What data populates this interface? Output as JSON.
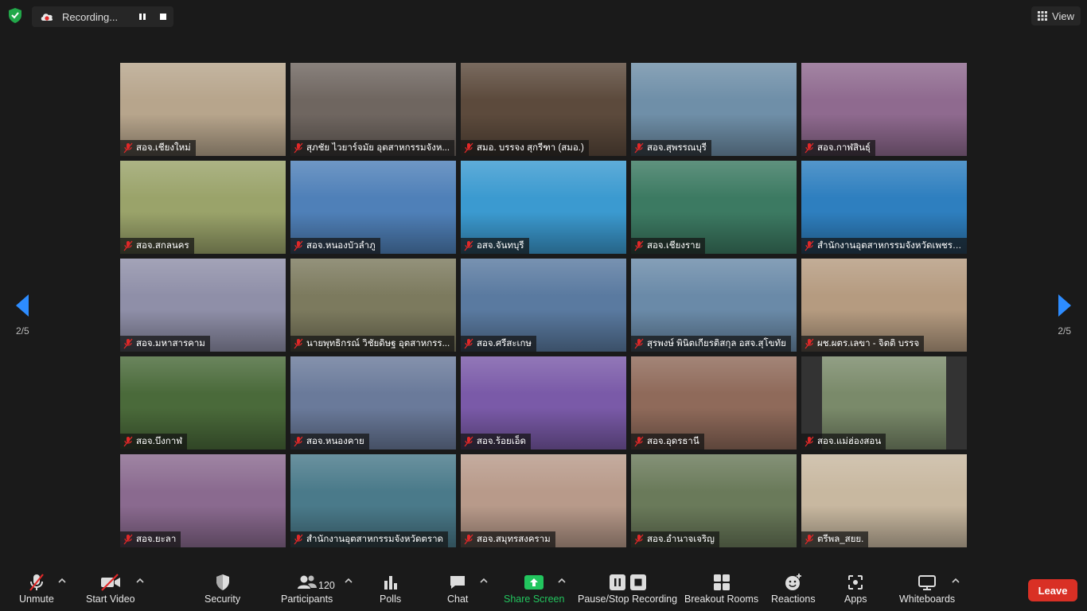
{
  "recording": {
    "label": "Recording..."
  },
  "view": {
    "label": "View"
  },
  "pagination": {
    "left": "2/5",
    "right": "2/5"
  },
  "tiles": [
    {
      "name": "สอจ.เชียงใหม่",
      "bg": "#b7a58c"
    },
    {
      "name": "สุภชัย ไวยาร์จมัย อุตสาหกรรมจังห...",
      "bg": "#6f6660"
    },
    {
      "name": "สมอ. บรรจง สุกรีฑา (สมอ.)",
      "bg": "#5c4a3c"
    },
    {
      "name": "สอจ.สุพรรณบุรี",
      "bg": "#6f8fa8"
    },
    {
      "name": "สอจ.กาฬสินธุ์",
      "bg": "#8f6a8f"
    },
    {
      "name": "สอจ.สกลนคร",
      "bg": "#9aa36a"
    },
    {
      "name": "สอจ.หนองบัวลำภู",
      "bg": "#4f80b8"
    },
    {
      "name": "อสจ.จันทบุรี",
      "bg": "#3b9ad0"
    },
    {
      "name": "สอจ.เชียงราย",
      "bg": "#3c7a62"
    },
    {
      "name": "สำนักงานอุตสาหกรรมจังหวัดเพชรบุรี",
      "bg": "#2e7fbf"
    },
    {
      "name": "สอจ.มหาสารคาม",
      "bg": "#8f8fa8"
    },
    {
      "name": "นายพุทธิกรณ์ วิชัยดิษฐ อุตสาหกรร...",
      "bg": "#7c7a5e"
    },
    {
      "name": "สอจ.ศรีสะเกษ",
      "bg": "#5a7aa0"
    },
    {
      "name": "สุรพงษ์ พินิตเกียรติสกุล อสจ.สุโขทัย",
      "bg": "#6a8aa8"
    },
    {
      "name": "ผช.ผตร.เลขา - จิตติ บรรจ",
      "bg": "#b59b80"
    },
    {
      "name": "สอจ.บึงกาฬ",
      "bg": "#4a6a3a"
    },
    {
      "name": "สอจ.หนองคาย",
      "bg": "#6a7a9a"
    },
    {
      "name": "สอจ.ร้อยเอ็ด",
      "bg": "#7a5aa8"
    },
    {
      "name": "สอจ.อุดรธานี",
      "bg": "#8f6a5a"
    },
    {
      "name": "สอจ.แม่ฮ่องสอน",
      "bg": "#7a8a6a"
    },
    {
      "name": "สอจ.ยะลา",
      "bg": "#8a6a8f"
    },
    {
      "name": "สำนักงานอุตสาหกรรมจังหวัดตราด",
      "bg": "#4a7a8a"
    },
    {
      "name": "สอจ.สมุทรสงคราม",
      "bg": "#b89a8a"
    },
    {
      "name": "สอจ.อำนาจเจริญ",
      "bg": "#6a7a5a"
    },
    {
      "name": "ตรีพล_สยย.",
      "bg": "#c8b8a0"
    }
  ],
  "toolbar": {
    "unmute": "Unmute",
    "start_video": "Start Video",
    "security": "Security",
    "participants": "Participants",
    "participants_count": "120",
    "polls": "Polls",
    "chat": "Chat",
    "share_screen": "Share Screen",
    "pause_stop_recording": "Pause/Stop Recording",
    "breakout_rooms": "Breakout Rooms",
    "reactions": "Reactions",
    "apps": "Apps",
    "whiteboards": "Whiteboards",
    "leave": "Leave"
  },
  "colors": {
    "share_green": "#22c55e",
    "leave_red": "#d93025",
    "nav_blue": "#2d8cff"
  }
}
